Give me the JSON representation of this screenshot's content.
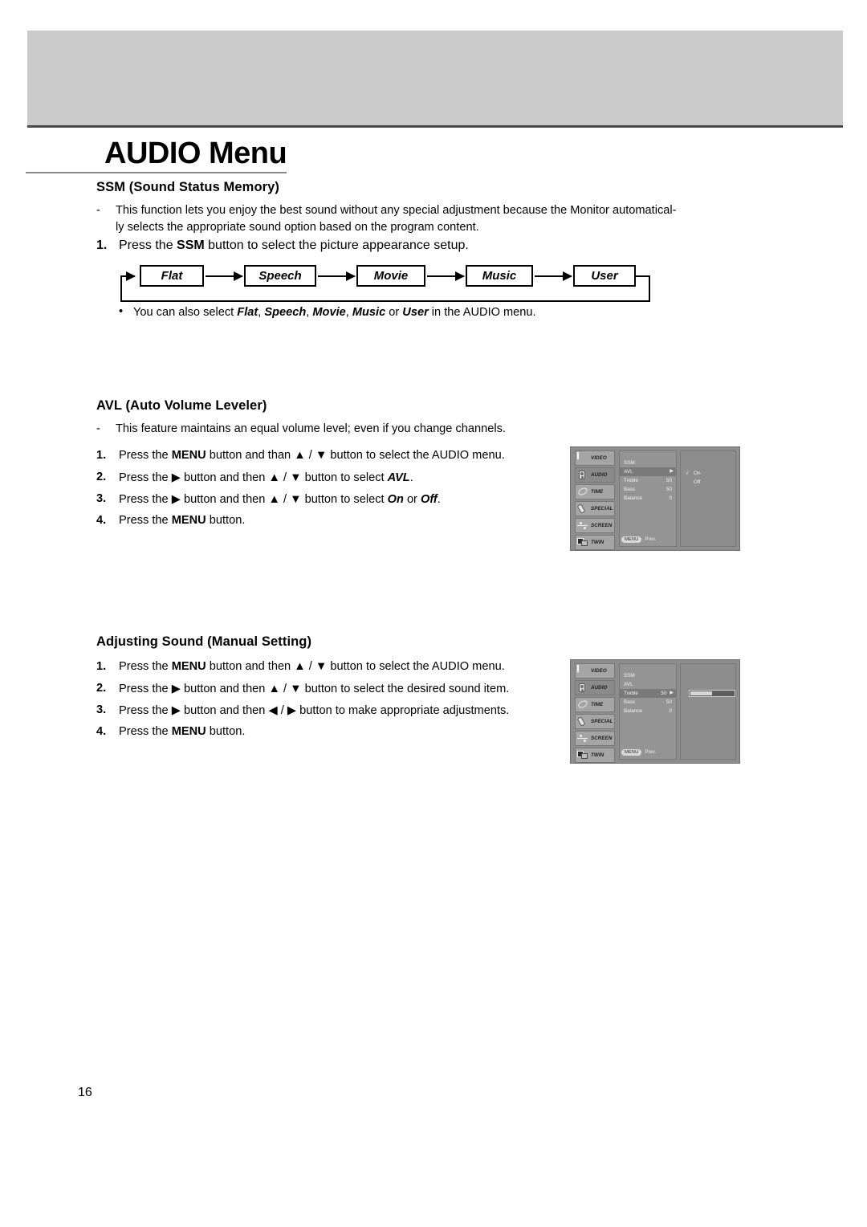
{
  "page": {
    "title": "AUDIO Menu",
    "number": "16"
  },
  "sections": {
    "ssm": {
      "heading": "SSM (Sound Status Memory)",
      "description_marker": "-",
      "description_line1": "This function lets you enjoy the best sound without any special adjustment because the Monitor automatical-",
      "description_line2": "ly selects the appropriate sound option based on the program content.",
      "step1_num": "1.",
      "step1_pre": "Press the ",
      "step1_bold": "SSM",
      "step1_post": " button to select the picture appearance setup.",
      "flow": [
        "Flat",
        "Speech",
        "Movie",
        "Music",
        "User"
      ],
      "note_bullet": "•",
      "note_pre": "You can also select ",
      "note_items": [
        "Flat",
        "Speech",
        "Movie",
        "Music",
        "User"
      ],
      "note_sep1": ", ",
      "note_sep_or": " or ",
      "note_post": " in the AUDIO menu."
    },
    "avl": {
      "heading": "AVL (Auto Volume Leveler)",
      "description_marker": "-",
      "description": "This feature maintains an equal volume level; even if you change channels.",
      "steps": [
        {
          "num": "1.",
          "parts": [
            "Press the ",
            "MENU",
            " button and than ▲ / ▼ button to select the AUDIO menu."
          ]
        },
        {
          "num": "2.",
          "parts": [
            "Press the ▶ button and then ▲ / ▼ button to select ",
            "AVL",
            "."
          ]
        },
        {
          "num": "3.",
          "parts": [
            "Press the ▶ button and then ▲ / ▼ button to select ",
            "On",
            " or ",
            "Off",
            "."
          ]
        },
        {
          "num": "4.",
          "parts": [
            "Press the ",
            "MENU",
            " button."
          ]
        }
      ]
    },
    "adjusting": {
      "heading": "Adjusting Sound (Manual Setting)",
      "steps": [
        {
          "num": "1.",
          "parts": [
            "Press the ",
            "MENU",
            " button and then ▲ / ▼ button to select the AUDIO menu."
          ]
        },
        {
          "num": "2.",
          "parts": [
            "Press the ▶ button and then ▲ / ▼ button to select the desired sound item."
          ]
        },
        {
          "num": "3.",
          "parts": [
            "Press the ▶ button and then ◀ / ▶ button to make appropriate adjustments."
          ]
        },
        {
          "num": "4.",
          "parts": [
            "Press the ",
            "MENU",
            " button."
          ]
        }
      ]
    }
  },
  "osd_avl": {
    "sidebar": [
      {
        "label": "VIDEO",
        "icon": "video-icon",
        "active": false
      },
      {
        "label": "AUDIO",
        "icon": "speaker-icon",
        "active": true
      },
      {
        "label": "TIME",
        "icon": "clock-icon",
        "active": false
      },
      {
        "label": "SPECIAL",
        "icon": "remote-icon",
        "active": false
      },
      {
        "label": "SCREEN",
        "icon": "screen-adjust-icon",
        "active": false
      },
      {
        "label": "TWIN",
        "icon": "twin-window-icon",
        "active": false
      }
    ],
    "menu": [
      {
        "label": "SSM",
        "value": "",
        "selected": false,
        "arrow": ""
      },
      {
        "label": "AVL",
        "value": "",
        "selected": true,
        "arrow": "▶"
      },
      {
        "label": "Treble",
        "value": "50",
        "selected": false,
        "arrow": ""
      },
      {
        "label": "Bass",
        "value": "50",
        "selected": false,
        "arrow": ""
      },
      {
        "label": "Balance",
        "value": "0",
        "selected": false,
        "arrow": ""
      }
    ],
    "options": [
      {
        "label": "On",
        "check": "√"
      },
      {
        "label": "Off",
        "check": ""
      }
    ],
    "footer_button": "MENU",
    "footer_label": "Prev."
  },
  "osd_manual": {
    "sidebar": [
      {
        "label": "VIDEO",
        "icon": "video-icon",
        "active": false
      },
      {
        "label": "AUDIO",
        "icon": "speaker-icon",
        "active": true
      },
      {
        "label": "TIME",
        "icon": "clock-icon",
        "active": false
      },
      {
        "label": "SPECIAL",
        "icon": "remote-icon",
        "active": false
      },
      {
        "label": "SCREEN",
        "icon": "screen-adjust-icon",
        "active": false
      },
      {
        "label": "TWIN",
        "icon": "twin-window-icon",
        "active": false
      }
    ],
    "menu": [
      {
        "label": "SSM",
        "value": "",
        "selected": false,
        "arrow": ""
      },
      {
        "label": "AVL",
        "value": "",
        "selected": false,
        "arrow": ""
      },
      {
        "label": "Treble",
        "value": "50",
        "selected": true,
        "arrow": "▶"
      },
      {
        "label": "Bass",
        "value": "50",
        "selected": false,
        "arrow": ""
      },
      {
        "label": "Balance",
        "value": "0",
        "selected": false,
        "arrow": ""
      }
    ],
    "slider_percent": 50,
    "footer_button": "MENU",
    "footer_label": "Prev."
  },
  "colors": {
    "header_band": "#cbcbcb",
    "osd_background": "#8d8d8d",
    "osd_selected": "#7a7a7a"
  }
}
